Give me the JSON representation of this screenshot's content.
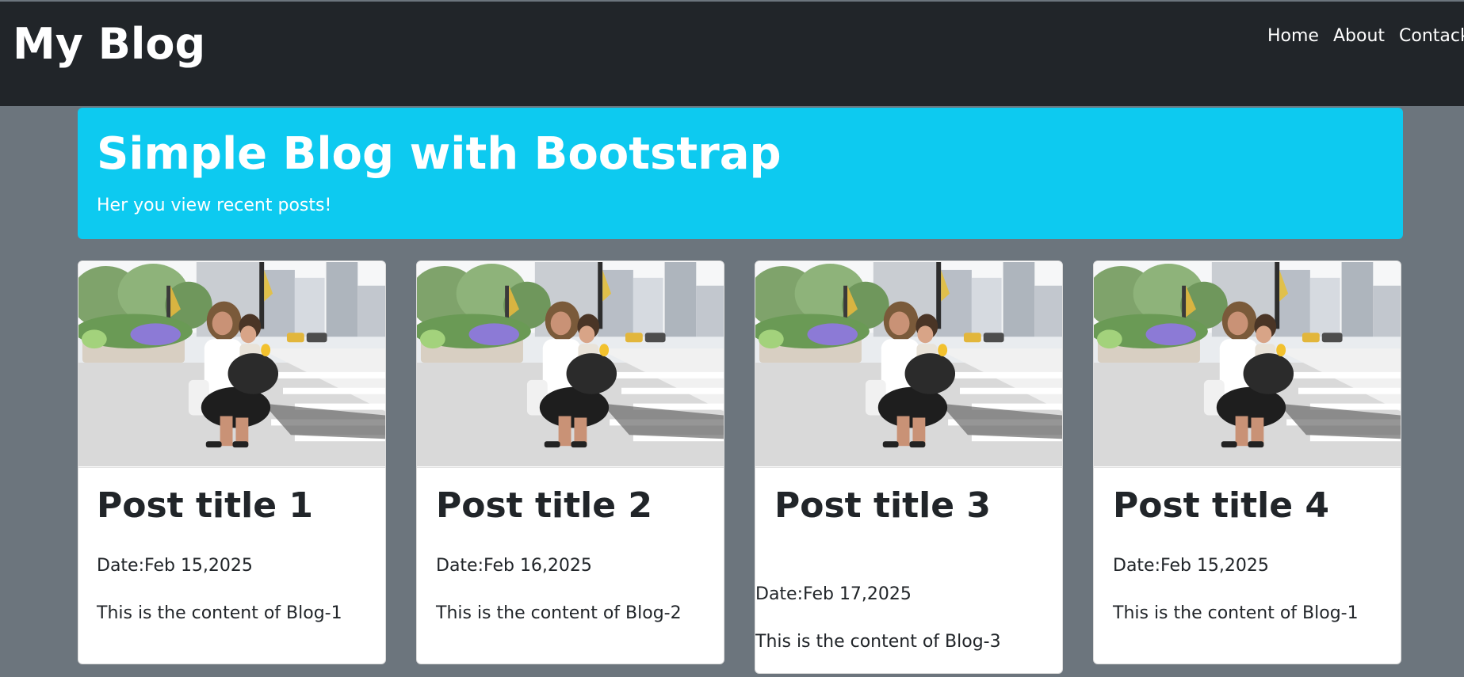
{
  "navbar": {
    "brand": "My Blog",
    "links": [
      "Home",
      "About",
      "Contack"
    ]
  },
  "hero": {
    "title": "Simple Blog with Bootstrap",
    "subtitle": "Her you view recent posts!"
  },
  "posts": [
    {
      "title": "Post title 1",
      "date": "Date:Feb 15,2025",
      "content": "This is the content of Blog-1"
    },
    {
      "title": "Post title 2",
      "date": "Date:Feb 16,2025",
      "content": "This is the content of Blog-2"
    },
    {
      "title": "Post title 3",
      "date": "Date:Feb 17,2025",
      "content": "This is the content of Blog-3"
    },
    {
      "title": "Post title 4",
      "date": "Date:Feb 15,2025",
      "content": "This is the content of Blog-1"
    }
  ],
  "colors": {
    "navbar_bg": "#212529",
    "page_bg": "#6c757d",
    "hero_bg": "#0dcaf0",
    "card_bg": "#ffffff",
    "text_dark": "#212529"
  }
}
